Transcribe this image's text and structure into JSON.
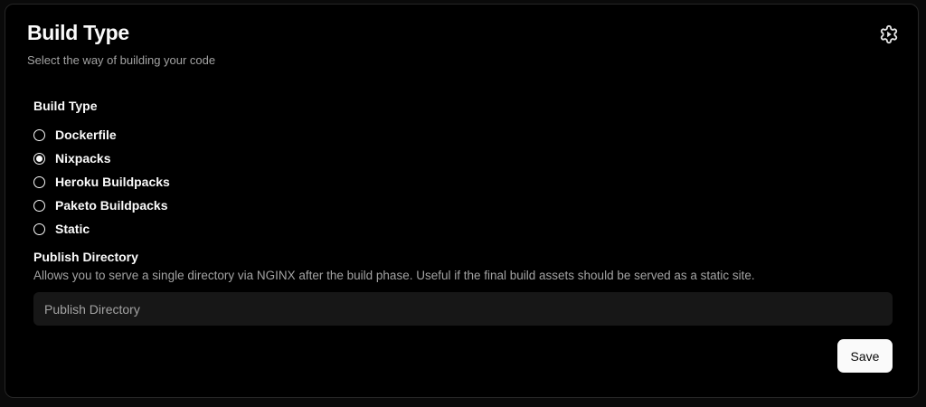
{
  "header": {
    "title": "Build Type",
    "description": "Select the way of building your code",
    "settings_icon": "gear-icon"
  },
  "build_type": {
    "label": "Build Type",
    "selected": "Nixpacks",
    "options": [
      {
        "label": "Dockerfile",
        "checked": false
      },
      {
        "label": "Nixpacks",
        "checked": true
      },
      {
        "label": "Heroku Buildpacks",
        "checked": false
      },
      {
        "label": "Paketo Buildpacks",
        "checked": false
      },
      {
        "label": "Static",
        "checked": false
      }
    ]
  },
  "publish_directory": {
    "label": "Publish Directory",
    "help": "Allows you to serve a single directory via NGINX after the build phase. Useful if the final build assets should be served as a static site.",
    "value": "",
    "placeholder": "Publish Directory"
  },
  "actions": {
    "save_label": "Save"
  },
  "colors": {
    "background": "#000000",
    "border": "#262626",
    "text": "#fafafa",
    "muted_text": "#a3a3a3",
    "input_bg": "#171717",
    "button_bg": "#fafafa",
    "button_text": "#0a0a0a"
  }
}
